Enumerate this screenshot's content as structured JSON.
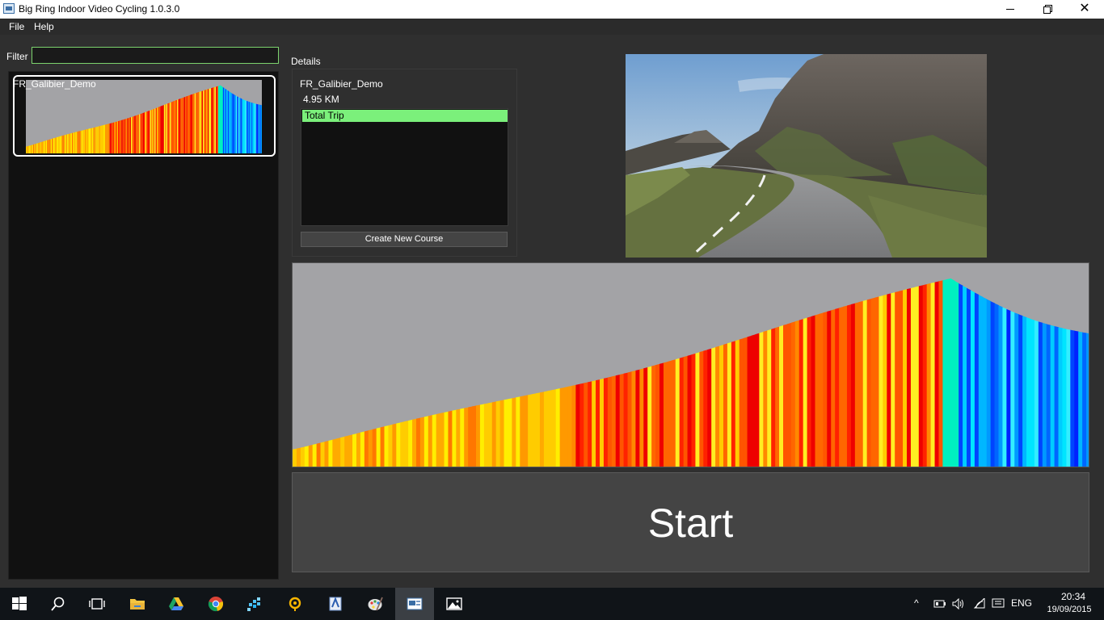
{
  "window": {
    "title": "Big Ring Indoor Video Cycling 1.0.3.0"
  },
  "menu": {
    "file": "File",
    "help": "Help"
  },
  "filter": {
    "label": "Filter",
    "value": ""
  },
  "course_list": {
    "items": [
      {
        "name": "FR_Galibier_Demo"
      }
    ]
  },
  "details": {
    "label": "Details",
    "course_name": "FR_Galibier_Demo",
    "distance": "4.95 KM",
    "trips": [
      "Total Trip"
    ],
    "create_button": "Create New Course"
  },
  "start_button": "Start",
  "taskbar": {
    "language": "ENG",
    "time": "20:34",
    "date": "19/09/2015"
  },
  "colors": {
    "accent_green": "#7bf07b",
    "filter_border": "#7cd36d",
    "background": "#2f2f2f",
    "list_background": "#111111",
    "profile_sky": "#a3a3a6"
  },
  "icons": [
    "windows-start-icon",
    "search-icon",
    "task-view-icon",
    "file-explorer-icon",
    "google-drive-icon",
    "chrome-icon",
    "app-icon",
    "app-icon",
    "app-icon",
    "paint-icon",
    "big-ring-icon",
    "photos-icon"
  ]
}
